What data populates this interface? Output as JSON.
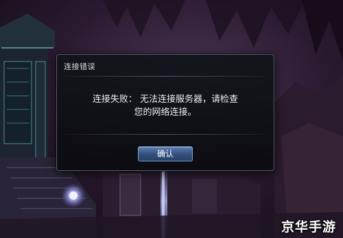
{
  "dialog": {
    "title": "连接错误",
    "message_line1": "连接失败： 无法连接服务器，请检查",
    "message_line2": "您的网络连接。",
    "confirm_label": "确认"
  },
  "watermark": {
    "text": "京华手游"
  },
  "colors": {
    "button_blue": "#34527e",
    "dialog_bg": "#0f1117",
    "scene_purple": "#3a2446"
  }
}
